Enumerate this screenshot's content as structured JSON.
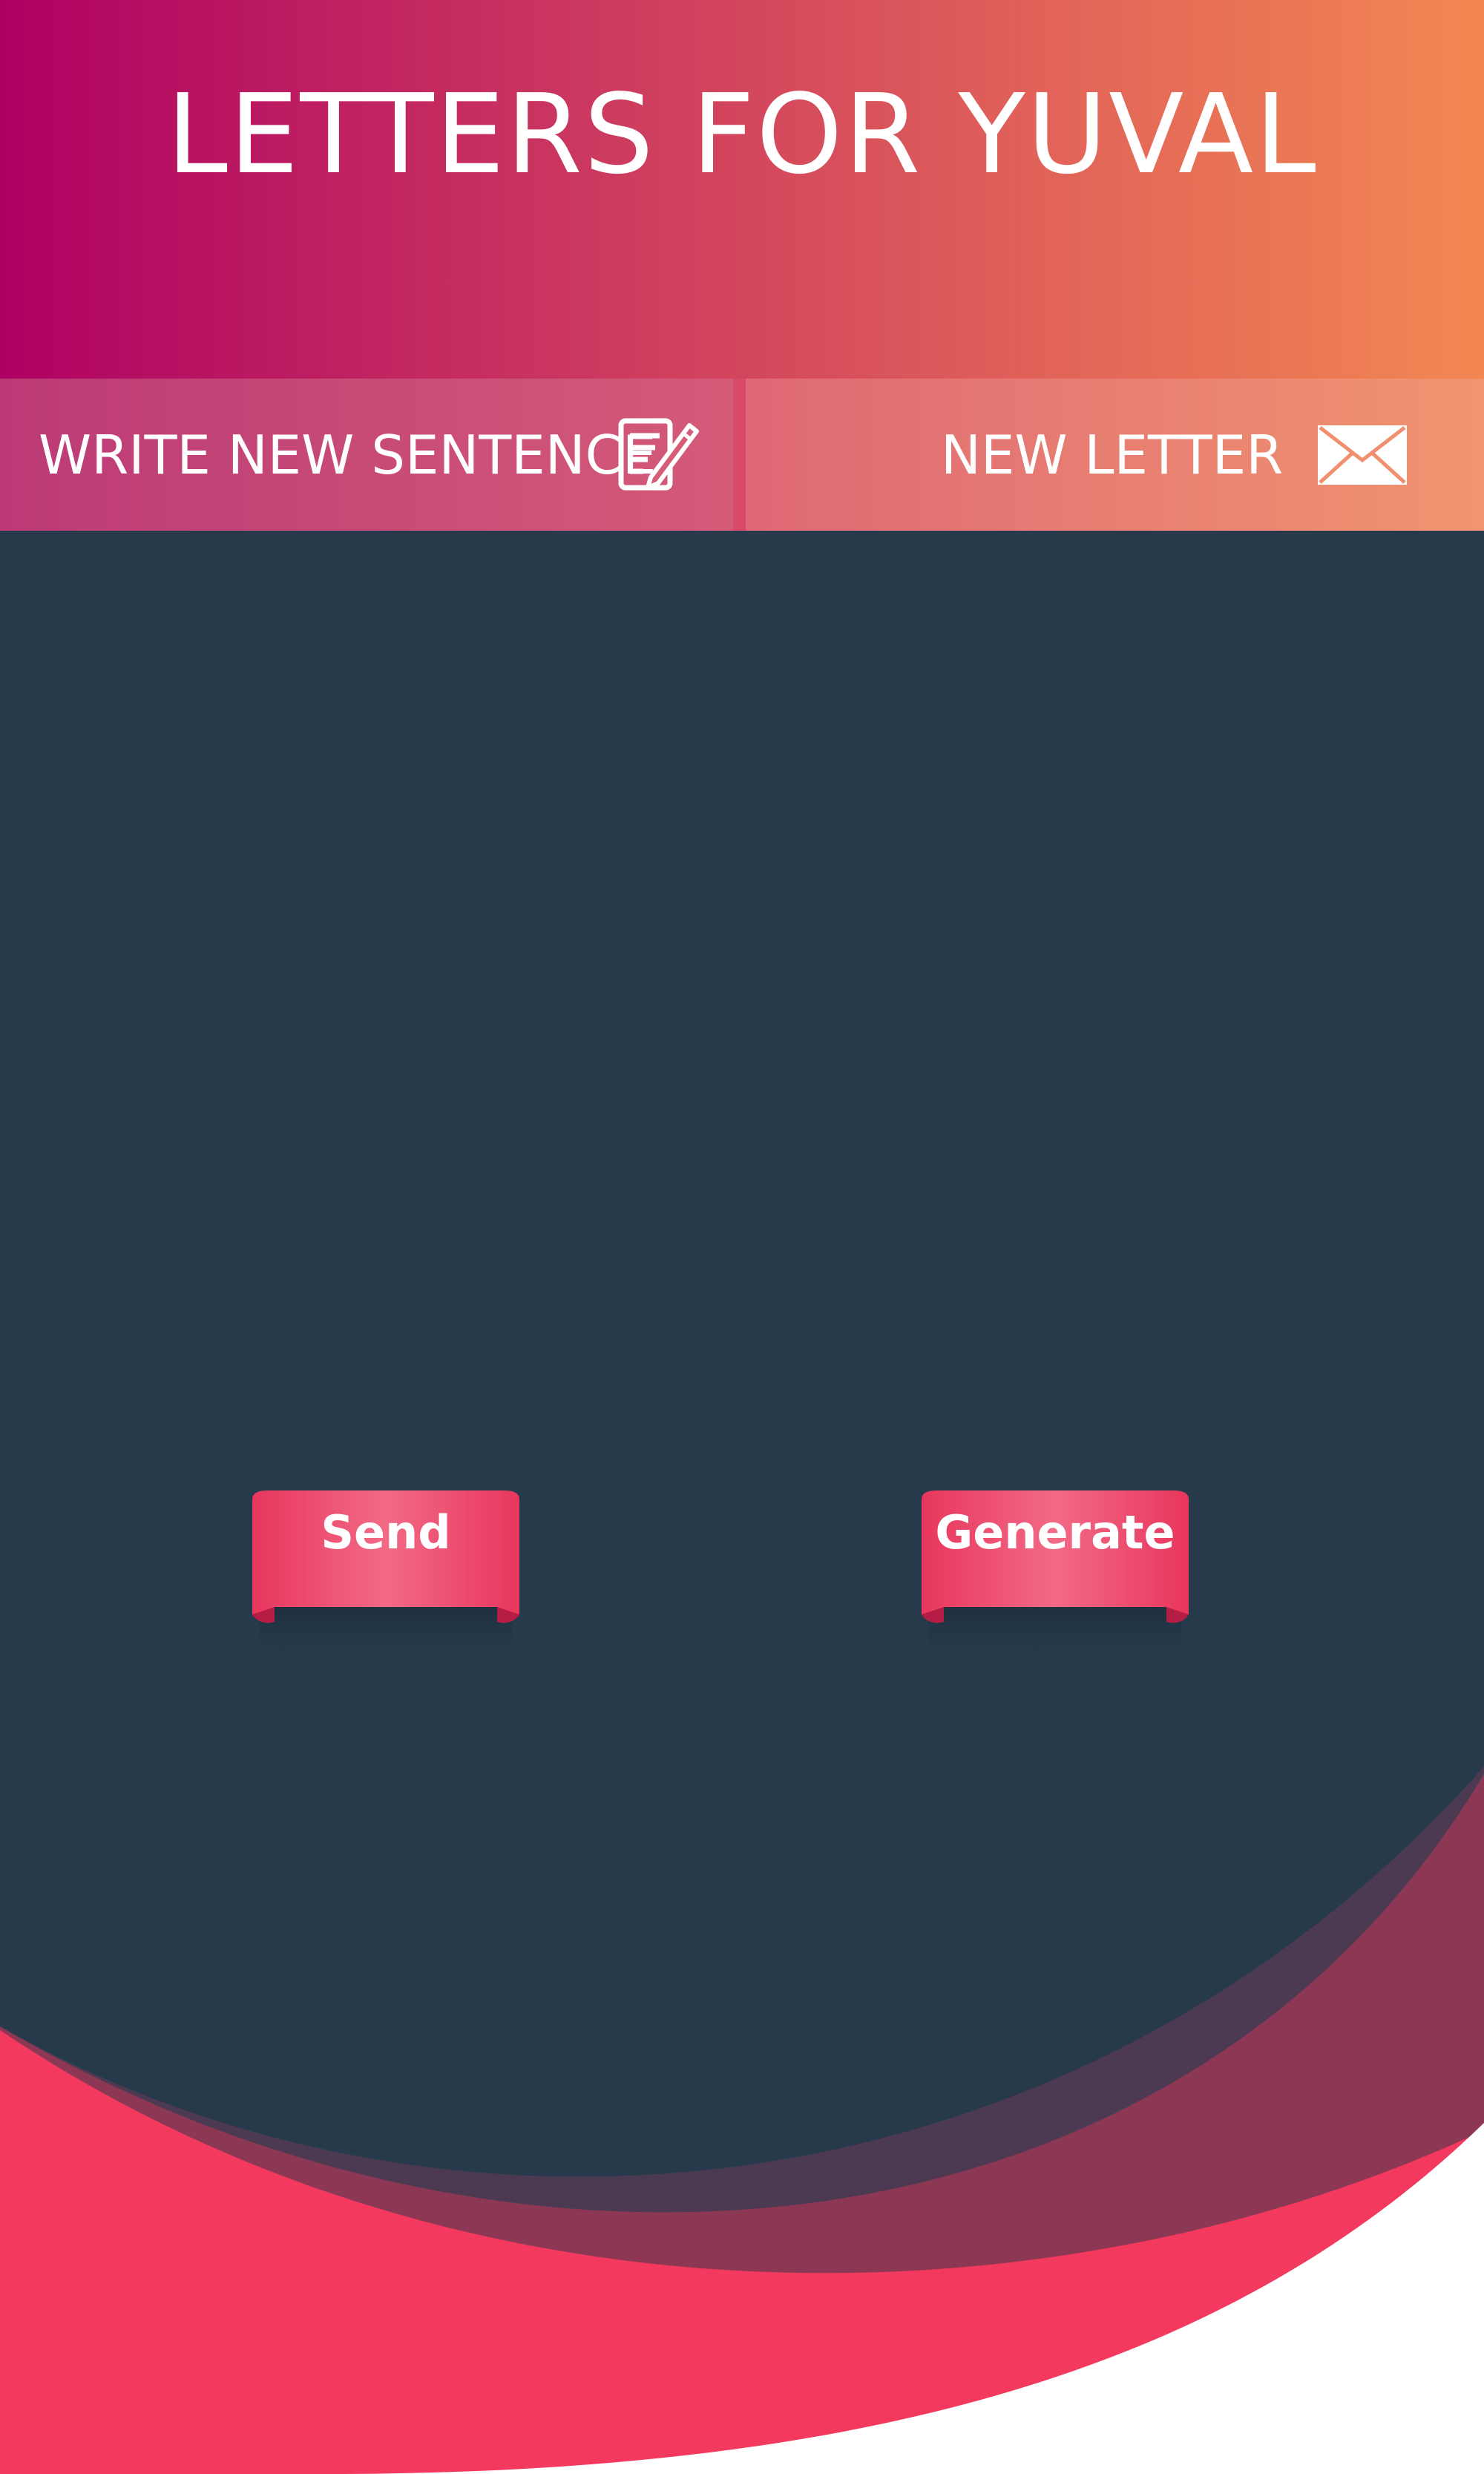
{
  "header": {
    "title": "LETTERS FOR YUVAL"
  },
  "toolbar": {
    "write_label": "WRITE NEW SENTENCE",
    "write_icon": "edit-document-icon",
    "letter_label": "NEW LETTER",
    "letter_icon": "envelope-icon"
  },
  "actions": {
    "send_label": "Send",
    "generate_label": "Generate"
  },
  "colors": {
    "header_start": "#ae0063",
    "header_end": "#f28752",
    "background": "#263a4c",
    "accent": "#f3395e",
    "wave_dark": "#8c3854"
  }
}
